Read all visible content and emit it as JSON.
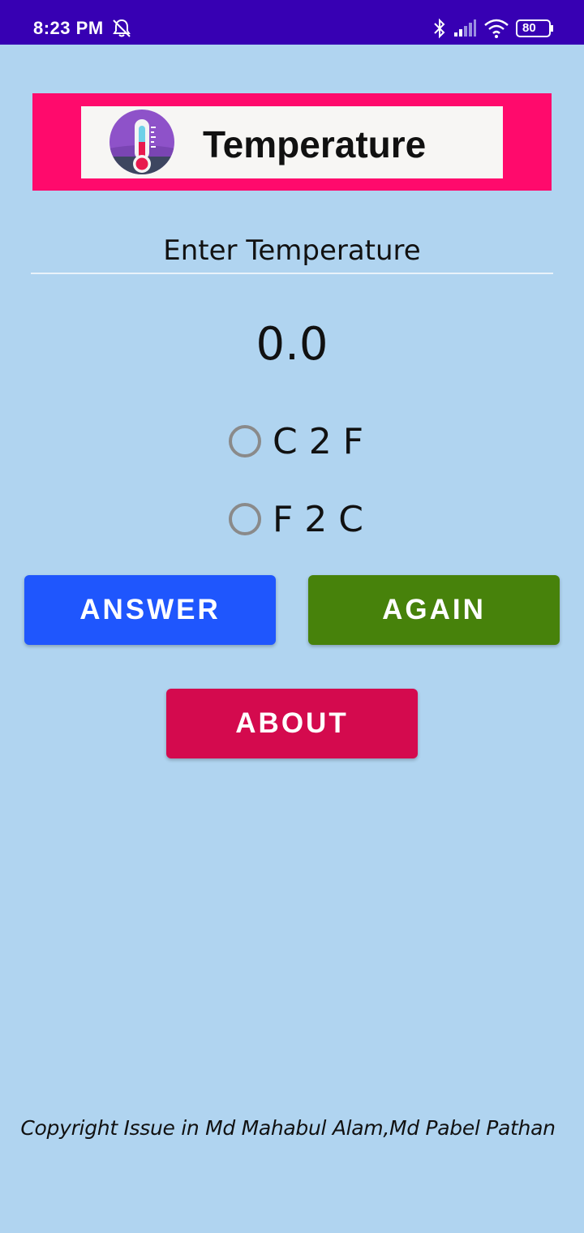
{
  "status_bar": {
    "time": "8:23 PM",
    "battery": "80",
    "icons": [
      "alarm-off-icon",
      "bluetooth-icon",
      "signal-icon",
      "wifi-icon",
      "battery-icon"
    ]
  },
  "header": {
    "title": "Temperature",
    "logo": "thermometer-icon",
    "colors": {
      "banner": "#ff0a6c",
      "card": "#f7f6f4"
    }
  },
  "input": {
    "placeholder": "Enter Temperature",
    "value": ""
  },
  "result": "0.0",
  "options": [
    {
      "label": "C 2 F",
      "checked": false
    },
    {
      "label": "F 2 C",
      "checked": false
    }
  ],
  "buttons": {
    "answer": "ANSWER",
    "again": "AGAIN",
    "about": "ABOUT"
  },
  "footer": {
    "copyright": "Copyright Issue in Md Mahabul Alam,Md Pabel Pathan"
  },
  "colors": {
    "background": "#b0d4f0",
    "status_bar": "#3700b3",
    "answer": "#1f56fd",
    "again": "#47820b",
    "about": "#d40a4e"
  }
}
